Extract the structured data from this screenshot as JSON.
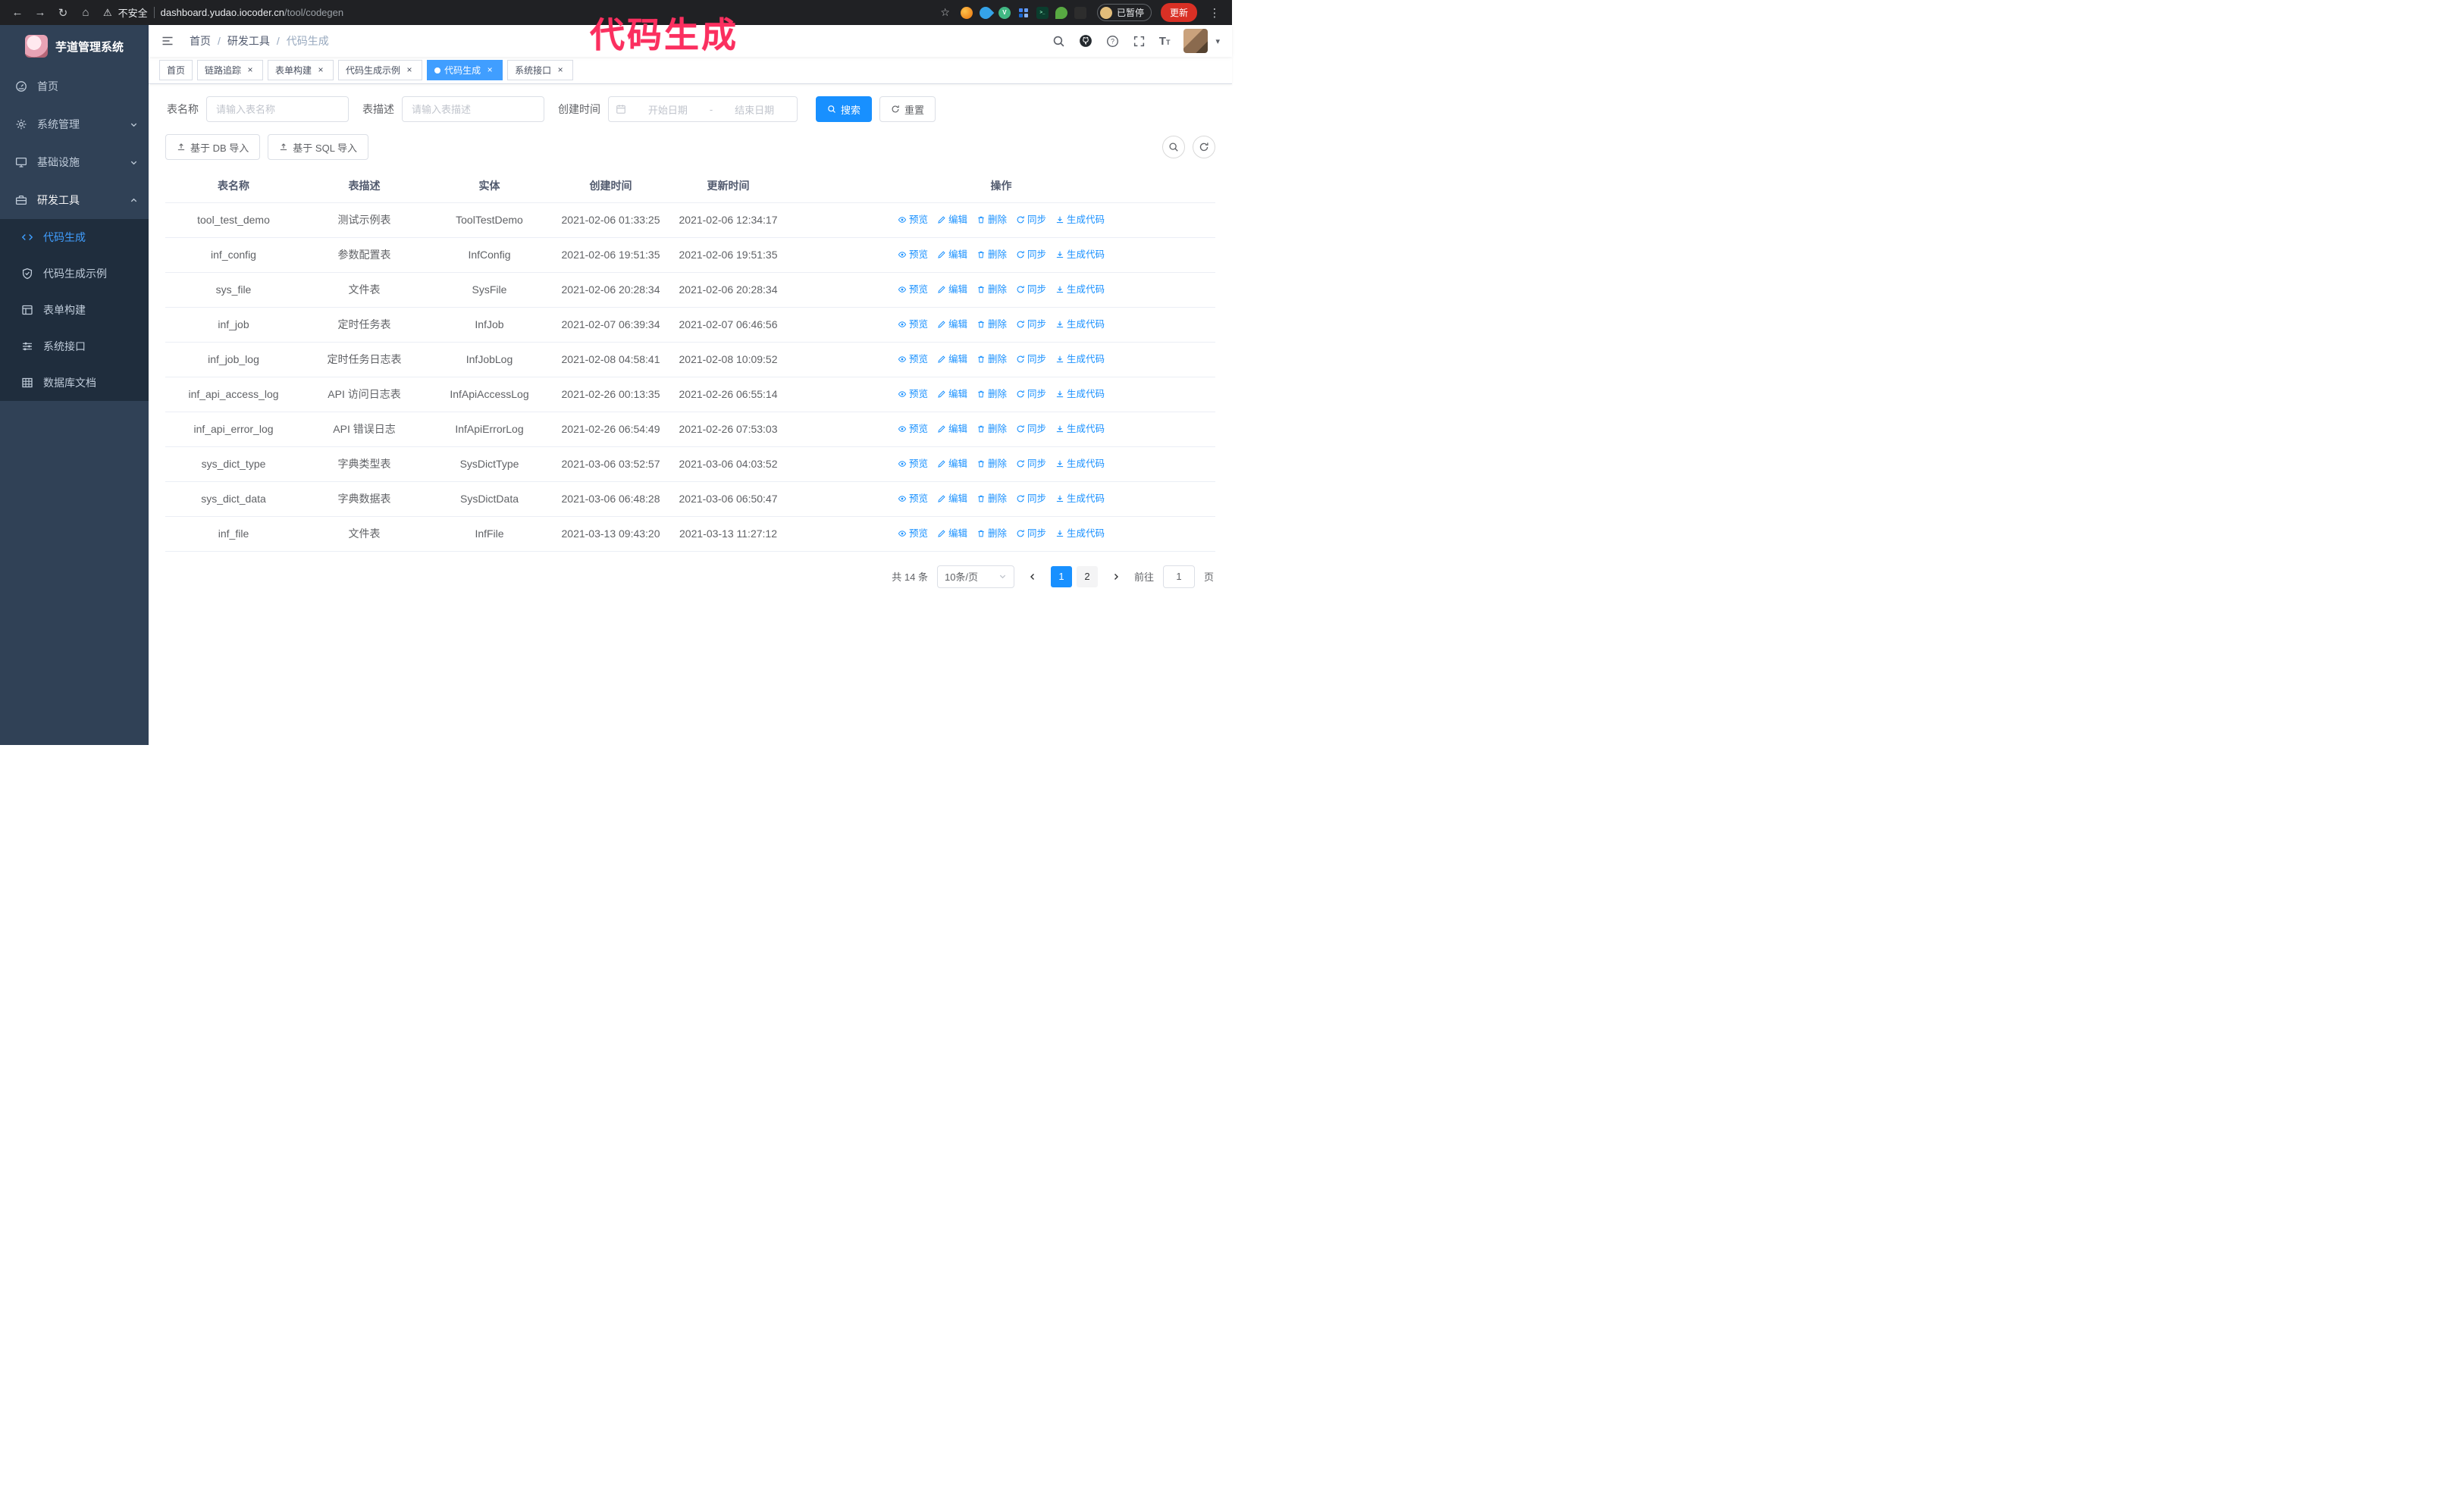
{
  "annotation": {
    "title": "代码生成"
  },
  "glyphs": {
    "back": "←",
    "forward": "→",
    "reload": "↻",
    "home": "⌂",
    "warning": "⚠",
    "star": "☆",
    "kebab": "⋮",
    "close": "×",
    "caret": "▾",
    "dash": "-",
    "font_size": "T"
  },
  "browser": {
    "insecure_label": "不安全",
    "url_host": "dashboard.yudao.iocoder.cn",
    "url_path": "/tool/codegen",
    "ext_v_glyph": "V",
    "ext_terminal_glyph": ">_",
    "paused_badge": "已暂停",
    "update_button": "更新"
  },
  "sidebar": {
    "logo_title": "芋道管理系统",
    "items": {
      "home": "首页",
      "system": "系统管理",
      "infra": "基础设施",
      "devtools": "研发工具"
    },
    "submenu": {
      "codegen": "代码生成",
      "codegen_example": "代码生成示例",
      "form_builder": "表单构建",
      "system_api": "系统接口",
      "db_doc": "数据库文档"
    }
  },
  "header": {
    "breadcrumb": [
      "首页",
      "研发工具",
      "代码生成"
    ]
  },
  "tabs": [
    {
      "label": "首页",
      "closable": false,
      "active": false
    },
    {
      "label": "链路追踪",
      "closable": true,
      "active": false
    },
    {
      "label": "表单构建",
      "closable": true,
      "active": false
    },
    {
      "label": "代码生成示例",
      "closable": true,
      "active": false
    },
    {
      "label": "代码生成",
      "closable": true,
      "active": true
    },
    {
      "label": "系统接口",
      "closable": true,
      "active": false
    }
  ],
  "filters": {
    "table_name_label": "表名称",
    "table_name_placeholder": "请输入表名称",
    "table_desc_label": "表描述",
    "table_desc_placeholder": "请输入表描述",
    "create_time_label": "创建时间",
    "start_date_placeholder": "开始日期",
    "end_date_placeholder": "结束日期",
    "search_button": "搜索",
    "reset_button": "重置"
  },
  "toolbar": {
    "import_db": "基于 DB 导入",
    "import_sql": "基于 SQL 导入"
  },
  "table": {
    "columns": [
      "表名称",
      "表描述",
      "实体",
      "创建时间",
      "更新时间",
      "操作"
    ],
    "actions": [
      "预览",
      "编辑",
      "删除",
      "同步",
      "生成代码"
    ],
    "rows": [
      {
        "name": "tool_test_demo",
        "desc": "测试示例表",
        "entity": "ToolTestDemo",
        "created": "2021-02-06 01:33:25",
        "updated": "2021-02-06 12:34:17"
      },
      {
        "name": "inf_config",
        "desc": "参数配置表",
        "entity": "InfConfig",
        "created": "2021-02-06 19:51:35",
        "updated": "2021-02-06 19:51:35"
      },
      {
        "name": "sys_file",
        "desc": "文件表",
        "entity": "SysFile",
        "created": "2021-02-06 20:28:34",
        "updated": "2021-02-06 20:28:34"
      },
      {
        "name": "inf_job",
        "desc": "定时任务表",
        "entity": "InfJob",
        "created": "2021-02-07 06:39:34",
        "updated": "2021-02-07 06:46:56"
      },
      {
        "name": "inf_job_log",
        "desc": "定时任务日志表",
        "entity": "InfJobLog",
        "created": "2021-02-08 04:58:41",
        "updated": "2021-02-08 10:09:52"
      },
      {
        "name": "inf_api_access_log",
        "desc": "API 访问日志表",
        "entity": "InfApiAccessLog",
        "created": "2021-02-26 00:13:35",
        "updated": "2021-02-26 06:55:14"
      },
      {
        "name": "inf_api_error_log",
        "desc": "API 错误日志",
        "entity": "InfApiErrorLog",
        "created": "2021-02-26 06:54:49",
        "updated": "2021-02-26 07:53:03"
      },
      {
        "name": "sys_dict_type",
        "desc": "字典类型表",
        "entity": "SysDictType",
        "created": "2021-03-06 03:52:57",
        "updated": "2021-03-06 04:03:52"
      },
      {
        "name": "sys_dict_data",
        "desc": "字典数据表",
        "entity": "SysDictData",
        "created": "2021-03-06 06:48:28",
        "updated": "2021-03-06 06:50:47"
      },
      {
        "name": "inf_file",
        "desc": "文件表",
        "entity": "InfFile",
        "created": "2021-03-13 09:43:20",
        "updated": "2021-03-13 11:27:12"
      }
    ]
  },
  "pagination": {
    "total": "共 14 条",
    "page_size": "10条/页",
    "pages": [
      {
        "label": "1",
        "active": true
      },
      {
        "label": "2",
        "active": false
      }
    ],
    "goto_prefix": "前往",
    "goto_value": "1",
    "goto_suffix": "页"
  }
}
